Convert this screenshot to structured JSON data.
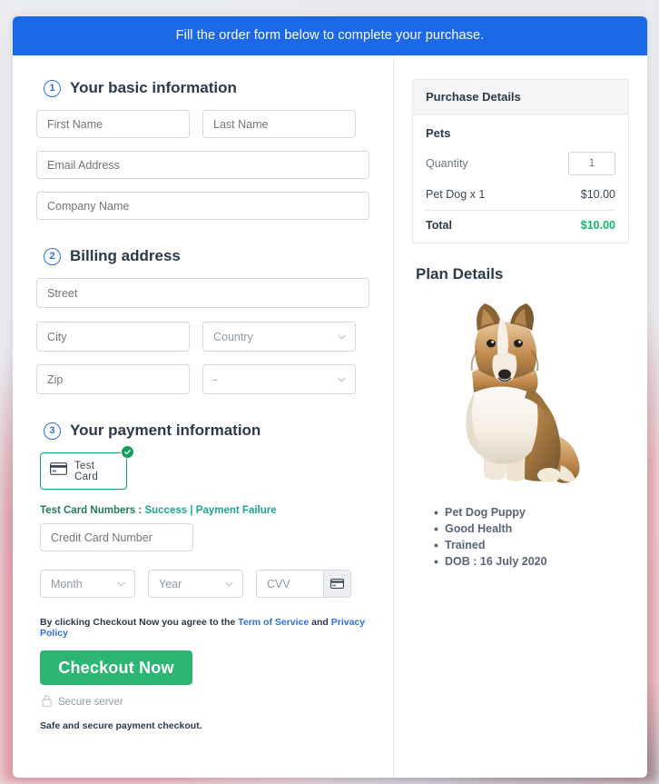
{
  "banner": {
    "text": "Fill the order form below to complete your purchase."
  },
  "sections": {
    "basic": {
      "number": "1",
      "title": "Your basic information",
      "first_name_placeholder": "First Name",
      "last_name_placeholder": "Last Name",
      "email_placeholder": "Email Address",
      "company_placeholder": "Company Name"
    },
    "billing": {
      "number": "2",
      "title": "Billing address",
      "street_placeholder": "Street",
      "city_placeholder": "City",
      "country_placeholder": "Country",
      "zip_placeholder": "Zip",
      "state_placeholder": "-"
    },
    "payment": {
      "number": "3",
      "title": "Your payment information",
      "card_option_label": "Test Card",
      "test_numbers_label": "Test Card Numbers :",
      "success_link": "Success",
      "separator": "|",
      "failure_link": "Payment Failure",
      "credit_card_placeholder": "Credit Card Number",
      "month_placeholder": "Month",
      "year_placeholder": "Year",
      "cvv_placeholder": "CVV",
      "terms_prefix": "By clicking Checkout Now you agree to the",
      "terms_link": "Term of Service",
      "terms_and": "and",
      "privacy_link": "Privacy Policy",
      "checkout_label": "Checkout Now",
      "secure_server_label": "Secure server",
      "safe_note": "Safe and secure payment checkout."
    }
  },
  "purchase_details": {
    "header": "Purchase Details",
    "group_label": "Pets",
    "quantity_label": "Quantity",
    "quantity_value": "1",
    "line_item_label": "Pet Dog x 1",
    "line_item_amount": "$10.00",
    "total_label": "Total",
    "total_amount": "$10.00"
  },
  "plan_details": {
    "title": "Plan Details",
    "image_alt": "shetland-sheepdog-photo",
    "features": [
      "Pet Dog Puppy",
      "Good Health",
      "Trained",
      "DOB : 16 July 2020"
    ]
  },
  "colors": {
    "banner_blue": "#1b68e8",
    "accent_blue": "#2f6fe0",
    "checkout_green": "#2bb673",
    "card_border_green": "#12a05c",
    "total_green": "#12b86a",
    "test_link_teal": "#1aa78c"
  }
}
